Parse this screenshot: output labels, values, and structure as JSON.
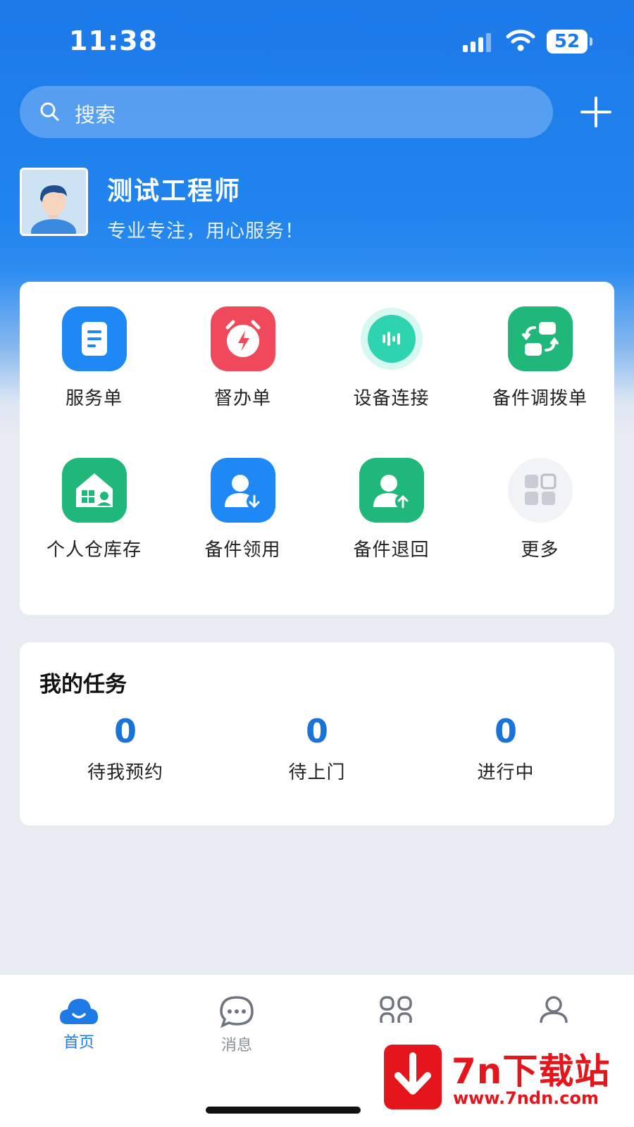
{
  "status_bar": {
    "time": "11:38",
    "battery": "52"
  },
  "search": {
    "placeholder": "搜索"
  },
  "profile": {
    "name": "测试工程师",
    "slogan": "专业专注，用心服务！"
  },
  "grid": [
    {
      "label": "服务单",
      "icon": "document-icon",
      "color": "#1e88f5"
    },
    {
      "label": "督办单",
      "icon": "alarm-clock-icon",
      "color": "#f0495b"
    },
    {
      "label": "设备连接",
      "icon": "sound-wave-icon",
      "color": "#2ed3b0"
    },
    {
      "label": "备件调拨单",
      "icon": "swap-icon",
      "color": "#1fb87a"
    },
    {
      "label": "个人仓库存",
      "icon": "warehouse-icon",
      "color": "#1fb87a"
    },
    {
      "label": "备件领用",
      "icon": "user-download-icon",
      "color": "#1e88f5"
    },
    {
      "label": "备件退回",
      "icon": "user-upload-icon",
      "color": "#1fb87a"
    },
    {
      "label": "更多",
      "icon": "more-grid-icon",
      "color": "#c9ccd4"
    }
  ],
  "tasks": {
    "title": "我的任务",
    "stats": [
      {
        "value": "0",
        "label": "待我预约"
      },
      {
        "value": "0",
        "label": "待上门"
      },
      {
        "value": "0",
        "label": "进行中"
      }
    ]
  },
  "tabbar": {
    "items": [
      {
        "label": "首页",
        "active": true
      },
      {
        "label": "消息",
        "active": false
      },
      {
        "label": "",
        "active": false
      },
      {
        "label": "",
        "active": false
      }
    ],
    "active_color": "#1e7be6",
    "inactive_color": "#8a8f99"
  },
  "watermark": {
    "title": "7n下载站",
    "url": "www.7ndn.com"
  }
}
